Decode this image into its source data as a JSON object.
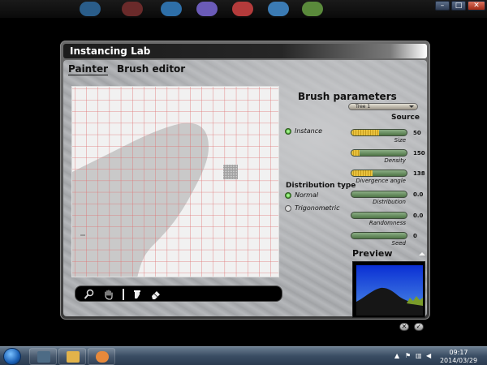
{
  "window": {
    "title": "Instancing Lab"
  },
  "tabs": {
    "painter": "Painter",
    "brush_editor": "Brush editor"
  },
  "brush_params": {
    "title": "Brush parameters",
    "tree_select": "Tree 1",
    "source_label": "Source",
    "instance_label": "Instance",
    "distribution_type_title": "Distribution type",
    "normal_label": "Normal",
    "trigonometric_label": "Trigonometric",
    "sliders": [
      {
        "label": "Size",
        "value": "50",
        "fraction": 0.5
      },
      {
        "label": "Density",
        "value": "150",
        "fraction": 0.15
      },
      {
        "label": "Divergence angle",
        "value": "138",
        "fraction": 0.38
      },
      {
        "label": "Distribution",
        "value": "0.0",
        "fraction": 0.0
      },
      {
        "label": "Randomness",
        "value": "0.0",
        "fraction": 0.0
      },
      {
        "label": "Seed",
        "value": "0",
        "fraction": 0.0
      }
    ]
  },
  "preview": {
    "title": "Preview"
  },
  "taskbar": {
    "time": "09:17",
    "date": "2014/03/29"
  },
  "colors": {
    "grid_line": "#e06060",
    "painted_area": "#c8c8c8",
    "slider_track": "#6f9567",
    "slider_fill": "#e0b632",
    "radio_on": "#4caf3a"
  }
}
